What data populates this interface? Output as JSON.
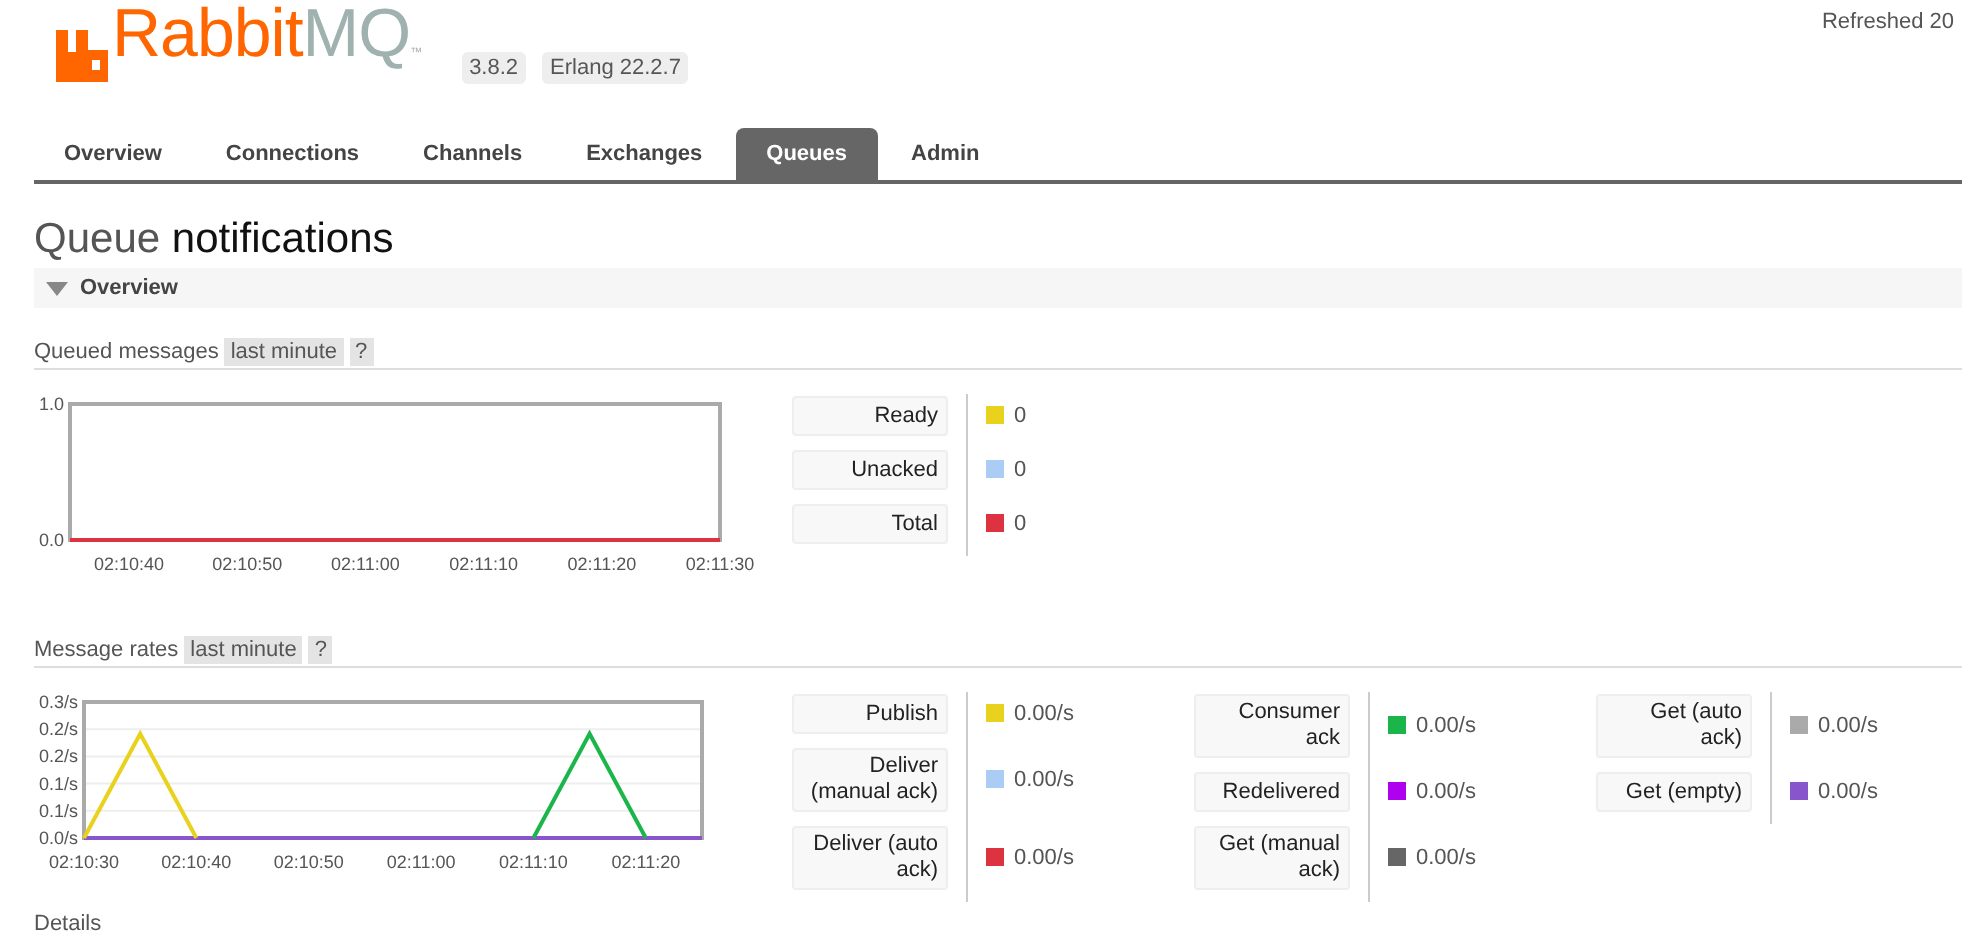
{
  "logo": {
    "text_primary": "Rabbit",
    "text_secondary": "MQ",
    "trademark": "™"
  },
  "versions": [
    "3.8.2",
    "Erlang 22.2.7"
  ],
  "refreshed": "Refreshed 20",
  "tabs": [
    {
      "label": "Overview",
      "selected": false
    },
    {
      "label": "Connections",
      "selected": false
    },
    {
      "label": "Channels",
      "selected": false
    },
    {
      "label": "Exchanges",
      "selected": false
    },
    {
      "label": "Queues",
      "selected": true
    },
    {
      "label": "Admin",
      "selected": false
    }
  ],
  "page_title": {
    "prefix": "Queue",
    "name": "notifications"
  },
  "section": {
    "title": "Overview",
    "expanded": true
  },
  "panels": [
    {
      "title": "Queued messages",
      "range": "last minute",
      "help": "?",
      "chart_data": {
        "type": "line",
        "categories": [
          null,
          "02:10:40",
          null,
          "02:10:50",
          null,
          "02:11:00",
          null,
          "02:11:10",
          null,
          "02:11:20",
          null,
          "02:11:30"
        ],
        "ylim": [
          0,
          1
        ],
        "yticks": [
          {
            "value": 0,
            "label": "0.0"
          },
          {
            "value": 1,
            "label": "1.0"
          }
        ],
        "series": [
          {
            "color": "#dd3340",
            "values": [
              0,
              0,
              0,
              0,
              0,
              0,
              0,
              0,
              0,
              0,
              0,
              0
            ]
          }
        ]
      },
      "legend_columns": [
        {
          "items": [
            {
              "label": "Ready",
              "color": "#e8d21d",
              "value": "0"
            },
            {
              "label": "Unacked",
              "color": "#aaccf5",
              "value": "0"
            },
            {
              "label": "Total",
              "color": "#dd3340",
              "value": "0"
            }
          ]
        }
      ]
    },
    {
      "title": "Message rates",
      "range": "last minute",
      "help": "?",
      "chart_data": {
        "type": "line",
        "grid": true,
        "categories": [
          "02:10:30",
          null,
          "02:10:40",
          null,
          "02:10:50",
          null,
          "02:11:00",
          null,
          "02:11:10",
          null,
          "02:11:20",
          null
        ],
        "ylim": [
          0,
          0.3
        ],
        "yticks": [
          {
            "value": 0,
            "label": "0.0/s"
          },
          {
            "value": 0.06,
            "label": "0.1/s"
          },
          {
            "value": 0.12,
            "label": "0.1/s"
          },
          {
            "value": 0.18,
            "label": "0.2/s"
          },
          {
            "value": 0.24,
            "label": "0.2/s"
          },
          {
            "value": 0.3,
            "label": "0.3/s"
          }
        ],
        "series": [
          {
            "color": "#8855cc",
            "values": [
              0,
              0,
              0,
              0,
              0,
              0,
              0,
              0,
              0,
              0,
              0,
              0
            ]
          },
          {
            "color": "#e8d21d",
            "values": [
              0,
              0.23,
              0,
              null,
              null,
              null,
              null,
              null,
              null,
              null,
              null,
              null
            ]
          },
          {
            "color": "#1ab54b",
            "values": [
              null,
              null,
              null,
              null,
              null,
              null,
              null,
              null,
              0,
              0.23,
              0,
              null
            ]
          }
        ]
      },
      "legend_columns": [
        {
          "items": [
            {
              "label": "Publish",
              "color": "#e8d21d",
              "value": "0.00/s"
            },
            {
              "label": "Deliver (manual ack)",
              "color": "#aaccf5",
              "value": "0.00/s"
            },
            {
              "label": "Deliver (auto ack)",
              "color": "#dd3340",
              "value": "0.00/s"
            }
          ]
        },
        {
          "items": [
            {
              "label": "Consumer ack",
              "color": "#1ab54b",
              "value": "0.00/s"
            },
            {
              "label": "Redelivered",
              "color": "#b000f0",
              "value": "0.00/s"
            },
            {
              "label": "Get (manual ack)",
              "color": "#666666",
              "value": "0.00/s"
            }
          ]
        },
        {
          "items": [
            {
              "label": "Get (auto ack)",
              "color": "#aaaaaa",
              "value": "0.00/s"
            },
            {
              "label": "Get (empty)",
              "color": "#8855cc",
              "value": "0.00/s"
            }
          ]
        }
      ]
    }
  ],
  "next_section": "Details"
}
